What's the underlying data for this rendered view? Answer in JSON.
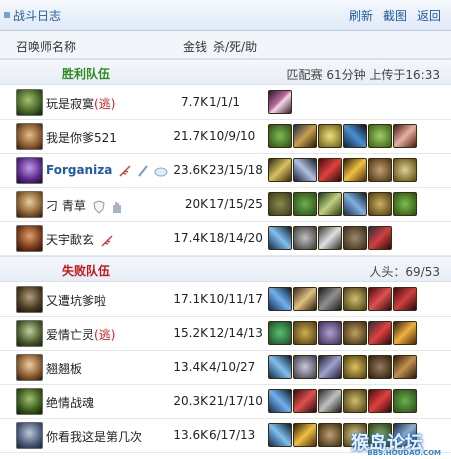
{
  "header": {
    "title": "战斗日志",
    "refresh": "刷新",
    "screenshot": "截图",
    "back": "返回"
  },
  "columns": {
    "name": "召唤师名称",
    "gold": "金钱",
    "kda": "杀/死/助"
  },
  "win_team": {
    "label": "胜利队伍",
    "meta": "匹配赛 61分钟 上传于16:33"
  },
  "lose_team": {
    "label": "失败队伍",
    "meta": "人头：69/53"
  },
  "escape_tag": "(逃)",
  "players": [
    {
      "name": "玩是寂寞",
      "escaped": true,
      "gold": "7.7K",
      "kda": "1/1/1",
      "items": 1
    },
    {
      "name": "我是你爹521",
      "escaped": false,
      "gold": "21.7K",
      "kda": "10/9/10",
      "items": 6
    },
    {
      "name": "Forganiza",
      "escaped": false,
      "gold": "23.6K",
      "kda": "23/15/18",
      "items": 6
    },
    {
      "name": "刁 青草",
      "escaped": false,
      "gold": "20K",
      "kda": "17/15/25",
      "items": 6
    },
    {
      "name": "天宇歃玄",
      "escaped": false,
      "gold": "17.4K",
      "kda": "18/14/20",
      "items": 5
    },
    {
      "name": "又遭坑爹啦",
      "escaped": false,
      "gold": "17.1K",
      "kda": "10/11/17",
      "items": 6
    },
    {
      "name": "爱情亡灵",
      "escaped": true,
      "gold": "15.2K",
      "kda": "12/14/13",
      "items": 6
    },
    {
      "name": "翘翘板",
      "escaped": false,
      "gold": "13.4K",
      "kda": "4/10/27",
      "items": 6
    },
    {
      "name": "绝情战魂",
      "escaped": false,
      "gold": "20.3K",
      "kda": "21/17/10",
      "items": 6
    },
    {
      "name": "你看我这是第几次",
      "escaped": false,
      "gold": "13.6K",
      "kda": "6/17/13",
      "items": 6
    }
  ],
  "colors": {
    "win": "#2e8b1e",
    "lose": "#c41818",
    "link": "#1f5aa5",
    "escape": "#d02020"
  },
  "watermark": {
    "text": "猴岛论坛",
    "sub": "BBS.HOUDAO.COM"
  }
}
